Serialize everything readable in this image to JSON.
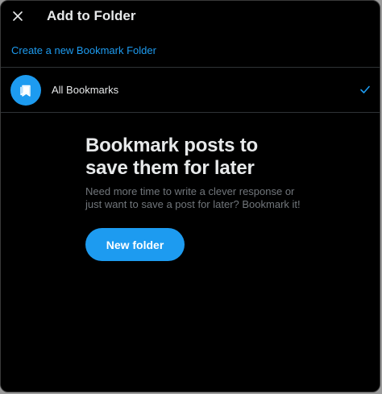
{
  "header": {
    "title": "Add to Folder",
    "close_icon": "close-icon"
  },
  "create_folder_link": "Create a new Bookmark Folder",
  "folders": [
    {
      "label": "All Bookmarks",
      "icon": "bookmark-folder-icon",
      "selected": true,
      "selected_icon": "checkmark-icon"
    }
  ],
  "empty_state": {
    "title": "Bookmark posts to save them for later",
    "description": "Need more time to write a clever response or just want to save a post for later? Bookmark it!",
    "button_label": "New folder"
  },
  "colors": {
    "accent": "#1d9bf0",
    "background": "#000000",
    "text_primary": "#e7e9ea",
    "text_secondary": "#71767b",
    "divider": "#2f3336"
  }
}
